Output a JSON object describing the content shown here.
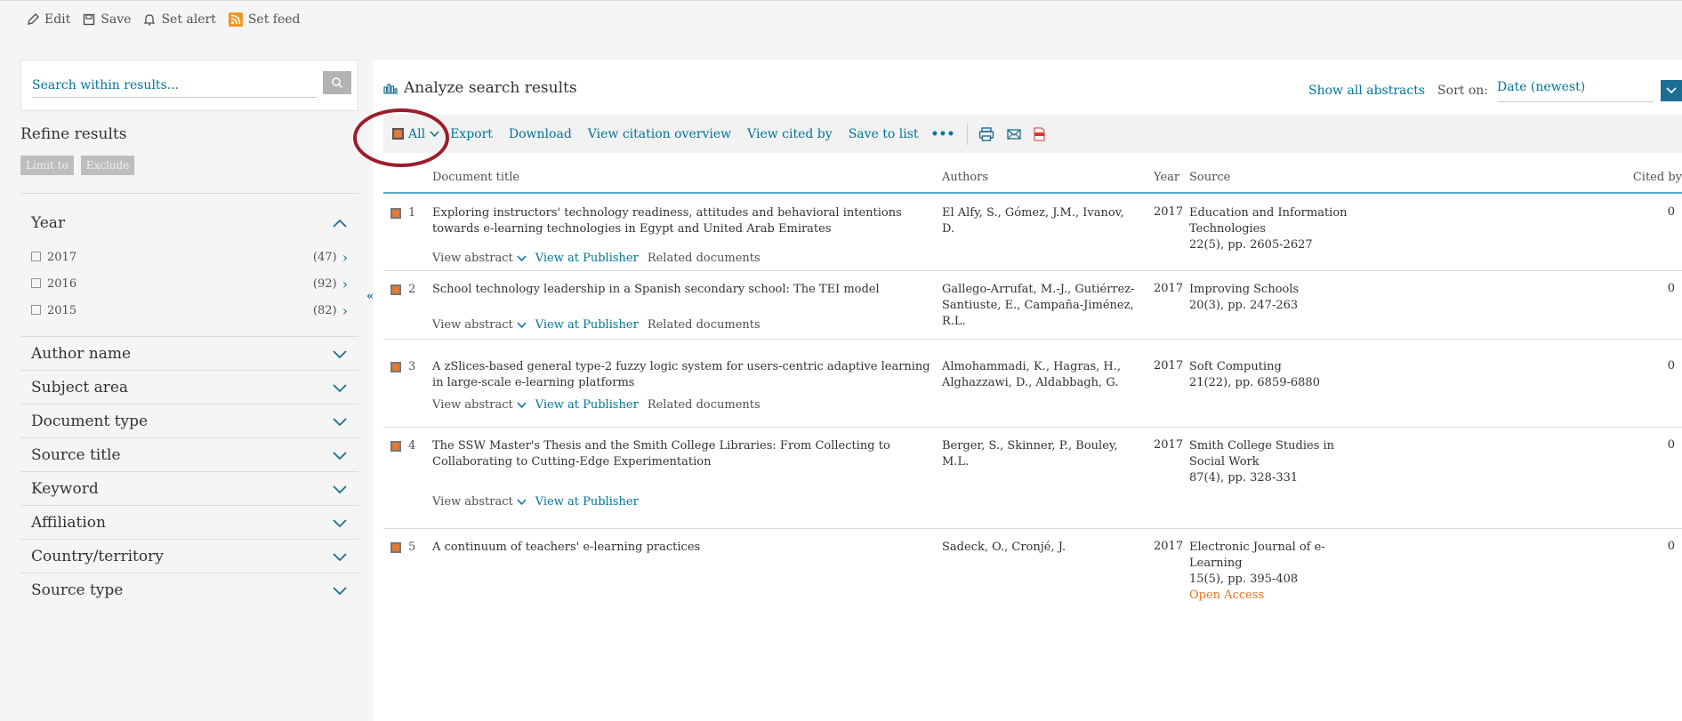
{
  "topbar": {
    "edit": "Edit",
    "save": "Save",
    "set_alert": "Set alert",
    "set_feed": "Set feed"
  },
  "sidebar": {
    "search_placeholder": "Search within results...",
    "refine_title": "Refine results",
    "limit_to": "Limit to",
    "exclude": "Exclude",
    "year_title": "Year",
    "years": [
      {
        "label": "2017",
        "count": "(47)"
      },
      {
        "label": "2016",
        "count": "(92)"
      },
      {
        "label": "2015",
        "count": "(82)"
      }
    ],
    "facets": [
      "Author name",
      "Subject area",
      "Document type",
      "Source title",
      "Keyword",
      "Affiliation",
      "Country/territory",
      "Source type"
    ]
  },
  "main": {
    "analyze": "Analyze search results",
    "show_all_abstracts": "Show all abstracts",
    "sort_on": "Sort on:",
    "sort_value": "Date (newest)",
    "toolbar": {
      "all": "All",
      "export": "Export",
      "download": "Download",
      "view_citation_overview": "View citation overview",
      "view_cited_by": "View cited by",
      "save_to_list": "Save to list",
      "more": "•••"
    },
    "columns": {
      "title": "Document title",
      "authors": "Authors",
      "year": "Year",
      "source": "Source",
      "cited_by": "Cited by"
    },
    "view_abstract": "View abstract",
    "view_at_publisher": "View at Publisher",
    "related_documents": "Related documents",
    "results": [
      {
        "num": "1",
        "title": "Exploring instructors' technology readiness, attitudes and behavioral intentions towards e-learning technologies in Egypt and United Arab Emirates",
        "authors": "El Alfy, S., Gómez, J.M., Ivanov, D.",
        "year": "2017",
        "source": "Education and Information Technologies",
        "source_detail": "22(5), pp. 2605-2627",
        "cited": "0"
      },
      {
        "num": "2",
        "title": "School technology leadership in a Spanish secondary school: The TEI model",
        "authors": "Gallego-Arrufat, M.-J., Gutiérrez-Santiuste, E., Campaña-Jiménez, R.L.",
        "year": "2017",
        "source": "Improving Schools",
        "source_detail": "20(3), pp. 247-263",
        "cited": "0"
      },
      {
        "num": "3",
        "title": "A zSlices-based general type-2 fuzzy logic system for users-centric adaptive learning in large-scale e-learning platforms",
        "authors": "Almohammadi, K., Hagras, H., Alghazzawi, D., Aldabbagh, G.",
        "year": "2017",
        "source": "Soft Computing",
        "source_detail": "21(22), pp. 6859-6880",
        "cited": "0"
      },
      {
        "num": "4",
        "title": "The SSW Master's Thesis and the Smith College Libraries: From Collecting to Collaborating to Cutting-Edge Experimentation",
        "authors": "Berger, S., Skinner, P., Bouley, M.L.",
        "year": "2017",
        "source": "Smith College Studies in Social Work",
        "source_detail": "87(4), pp. 328-331",
        "cited": "0"
      },
      {
        "num": "5",
        "title": "A continuum of teachers' e-learning practices",
        "authors": "Sadeck, O., Cronjé, J.",
        "year": "2017",
        "source": "Electronic Journal of e-Learning",
        "source_detail": "15(5), pp. 395-408",
        "open_access": "Open Access",
        "cited": "0"
      }
    ]
  },
  "colors": {
    "link": "#007398",
    "accent_orange": "#e07a36",
    "highlight_circle": "#9b1d2a",
    "open_access": "#e9711c"
  }
}
